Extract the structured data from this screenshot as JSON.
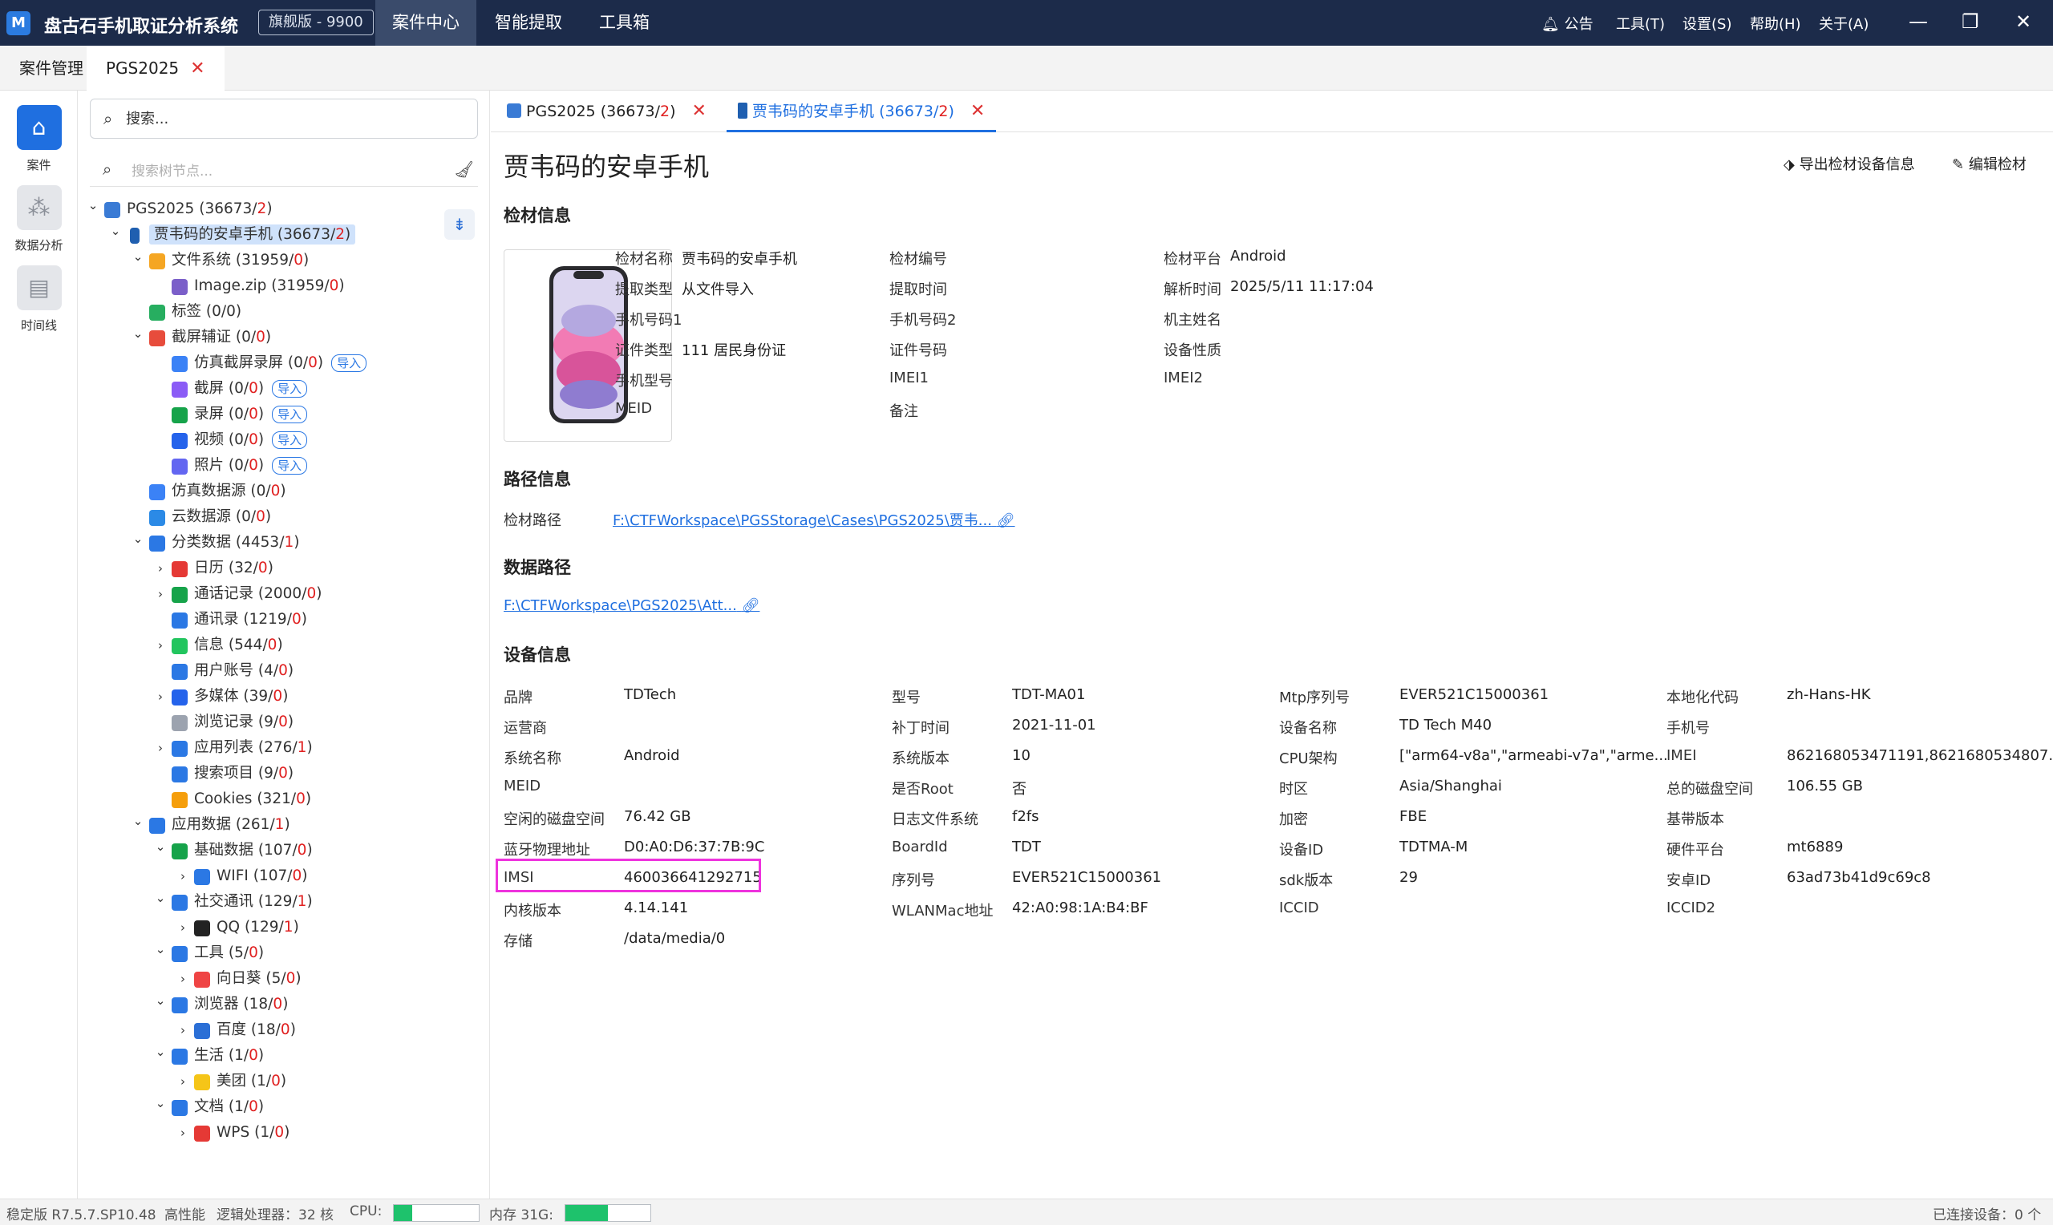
{
  "app": {
    "title": "盘古石手机取证分析系统",
    "edition": "旗舰版 - 9900",
    "logo_text": "M",
    "menus": [
      "案件中心",
      "智能提取",
      "工具箱"
    ],
    "right_menus": [
      "公告",
      "工具(T)",
      "设置(S)",
      "帮助(H)",
      "关于(A)"
    ]
  },
  "top_tabs": [
    {
      "label": "案件管理"
    },
    {
      "label": "PGS2025"
    }
  ],
  "rail": [
    {
      "label": "案件",
      "icon": "home-icon"
    },
    {
      "label": "数据分析",
      "icon": "share-icon"
    },
    {
      "label": "时间线",
      "icon": "timeline-icon"
    }
  ],
  "sidebar": {
    "search_placeholder": "搜索...",
    "tree_search_placeholder": "搜索树节点...",
    "import_label": "导入",
    "tree": [
      {
        "label": "PGS2025",
        "count": "36673",
        "red": "2",
        "level": 0,
        "chev": "open",
        "icon": "case-icon",
        "color": "#3a7bd5"
      },
      {
        "label": "贾韦码的安卓手机",
        "count": "36673",
        "red": "2",
        "level": 1,
        "chev": "open",
        "icon": "phone-icon",
        "color": "#1f5fb0",
        "selected": true
      },
      {
        "label": "文件系统",
        "count": "31959",
        "red": "0",
        "level": 2,
        "chev": "open",
        "icon": "folder-icon",
        "color": "#f5a623"
      },
      {
        "label": "Image.zip",
        "count": "31959",
        "red": "0",
        "level": 3,
        "chev": "",
        "icon": "zip-icon",
        "color": "#7b5fc9"
      },
      {
        "label": "标签",
        "count": "0",
        "red": "0",
        "level": 2,
        "chev": "",
        "icon": "tag-icon",
        "color": "#27ae60",
        "plain": true
      },
      {
        "label": "截屏辅证",
        "count": "0",
        "red": "0",
        "level": 2,
        "chev": "open",
        "icon": "screenshot-icon",
        "color": "#e74c3c"
      },
      {
        "label": "仿真截屏录屏",
        "count": "0",
        "red": "0",
        "level": 3,
        "chev": "",
        "icon": "emulate-icon",
        "color": "#3b82f6",
        "import": true
      },
      {
        "label": "截屏",
        "count": "0",
        "red": "0",
        "level": 3,
        "chev": "",
        "icon": "capture-icon",
        "color": "#8b5cf6",
        "import": true
      },
      {
        "label": "录屏",
        "count": "0",
        "red": "0",
        "level": 3,
        "chev": "",
        "icon": "record-icon",
        "color": "#16a34a",
        "import": true
      },
      {
        "label": "视频",
        "count": "0",
        "red": "0",
        "level": 3,
        "chev": "",
        "icon": "video-icon",
        "color": "#2563eb",
        "import": true
      },
      {
        "label": "照片",
        "count": "0",
        "red": "0",
        "level": 3,
        "chev": "",
        "icon": "photo-icon",
        "color": "#6366f1",
        "import": true
      },
      {
        "label": "仿真数据源",
        "count": "0",
        "red": "0",
        "level": 2,
        "chev": "",
        "icon": "sim-source-icon",
        "color": "#3b82f6"
      },
      {
        "label": "云数据源",
        "count": "0",
        "red": "0",
        "level": 2,
        "chev": "",
        "icon": "cloud-icon",
        "color": "#2b8ae6"
      },
      {
        "label": "分类数据",
        "count": "4453",
        "red": "1",
        "level": 2,
        "chev": "open",
        "icon": "category-icon",
        "color": "#2b78e4"
      },
      {
        "label": "日历",
        "count": "32",
        "red": "0",
        "level": 3,
        "chev": "closed",
        "icon": "calendar-icon",
        "color": "#e53935"
      },
      {
        "label": "通话记录",
        "count": "2000",
        "red": "0",
        "level": 3,
        "chev": "closed",
        "icon": "call-icon",
        "color": "#16a34a"
      },
      {
        "label": "通讯录",
        "count": "1219",
        "red": "0",
        "level": 3,
        "chev": "",
        "icon": "contacts-icon",
        "color": "#2b78e4"
      },
      {
        "label": "信息",
        "count": "544",
        "red": "0",
        "level": 3,
        "chev": "closed",
        "icon": "message-icon",
        "color": "#22c55e"
      },
      {
        "label": "用户账号",
        "count": "4",
        "red": "0",
        "level": 3,
        "chev": "",
        "icon": "account-icon",
        "color": "#2b78e4"
      },
      {
        "label": "多媒体",
        "count": "39",
        "red": "0",
        "level": 3,
        "chev": "closed",
        "icon": "media-icon",
        "color": "#2563eb"
      },
      {
        "label": "浏览记录",
        "count": "9",
        "red": "0",
        "level": 3,
        "chev": "",
        "icon": "history-icon",
        "color": "#9ca3af"
      },
      {
        "label": "应用列表",
        "count": "276",
        "red": "1",
        "level": 3,
        "chev": "closed",
        "icon": "applist-icon",
        "color": "#2b78e4"
      },
      {
        "label": "搜索项目",
        "count": "9",
        "red": "0",
        "level": 3,
        "chev": "",
        "icon": "search-item-icon",
        "color": "#2b78e4"
      },
      {
        "label": "Cookies",
        "count": "321",
        "red": "0",
        "level": 3,
        "chev": "",
        "icon": "cookie-icon",
        "color": "#f59e0b"
      },
      {
        "label": "应用数据",
        "count": "261",
        "red": "1",
        "level": 2,
        "chev": "open",
        "icon": "appdata-icon",
        "color": "#2b78e4"
      },
      {
        "label": "基础数据",
        "count": "107",
        "red": "0",
        "level": 3,
        "chev": "open",
        "icon": "basic-data-icon",
        "color": "#16a34a"
      },
      {
        "label": "WIFI",
        "count": "107",
        "red": "0",
        "level": 4,
        "chev": "closed",
        "icon": "wifi-icon",
        "color": "#2b78e4"
      },
      {
        "label": "社交通讯",
        "count": "129",
        "red": "1",
        "level": 3,
        "chev": "open",
        "icon": "social-icon",
        "color": "#2b78e4"
      },
      {
        "label": "QQ",
        "count": "129",
        "red": "1",
        "level": 4,
        "chev": "closed",
        "icon": "qq-icon",
        "color": "#222222"
      },
      {
        "label": "工具",
        "count": "5",
        "red": "0",
        "level": 3,
        "chev": "open",
        "icon": "tools-icon",
        "color": "#2b78e4"
      },
      {
        "label": "向日葵",
        "count": "5",
        "red": "0",
        "level": 4,
        "chev": "closed",
        "icon": "sunflower-icon",
        "color": "#ef4444"
      },
      {
        "label": "浏览器",
        "count": "18",
        "red": "0",
        "level": 3,
        "chev": "open",
        "icon": "browser-icon",
        "color": "#2b78e4"
      },
      {
        "label": "百度",
        "count": "18",
        "red": "0",
        "level": 4,
        "chev": "closed",
        "icon": "baidu-icon",
        "color": "#2b6fd6"
      },
      {
        "label": "生活",
        "count": "1",
        "red": "0",
        "level": 3,
        "chev": "open",
        "icon": "life-icon",
        "color": "#2b78e4"
      },
      {
        "label": "美团",
        "count": "1",
        "red": "0",
        "level": 4,
        "chev": "closed",
        "icon": "meituan-icon",
        "color": "#f5c518"
      },
      {
        "label": "文档",
        "count": "1",
        "red": "0",
        "level": 3,
        "chev": "open",
        "icon": "document-icon",
        "color": "#2b78e4"
      },
      {
        "label": "WPS",
        "count": "1",
        "red": "0",
        "level": 4,
        "chev": "closed",
        "icon": "wps-icon",
        "color": "#e53935"
      }
    ]
  },
  "main": {
    "tabs": [
      {
        "label": "PGS2025",
        "count": "36673",
        "red": "2"
      },
      {
        "label": "贾韦码的安卓手机",
        "count": "36673",
        "red": "2"
      }
    ],
    "device_title": "贾韦码的安卓手机",
    "export_label": "导出检材设备信息",
    "edit_label": "编辑检材",
    "section_material": "检材信息",
    "material_fields": [
      {
        "label": "检材名称",
        "value": "贾韦码的安卓手机"
      },
      {
        "label": "提取类型",
        "value": "从文件导入"
      },
      {
        "label": "手机号码1",
        "value": ""
      },
      {
        "label": "证件类型",
        "value": "111 居民身份证"
      },
      {
        "label": "手机型号",
        "value": ""
      },
      {
        "label": "MEID",
        "value": ""
      },
      {
        "label": "检材编号",
        "value": ""
      },
      {
        "label": "提取时间",
        "value": ""
      },
      {
        "label": "手机号码2",
        "value": ""
      },
      {
        "label": "证件号码",
        "value": ""
      },
      {
        "label": "IMEI1",
        "value": ""
      },
      {
        "label": "备注",
        "value": ""
      },
      {
        "label": "检材平台",
        "value": "Android"
      },
      {
        "label": "解析时间",
        "value": "2025/5/11 11:17:04"
      },
      {
        "label": "机主姓名",
        "value": ""
      },
      {
        "label": "设备性质",
        "value": ""
      },
      {
        "label": "IMEI2",
        "value": ""
      }
    ],
    "section_path": "路径信息",
    "path_label": "检材路径",
    "path_value": "F:\\CTFWorkspace\\PGSStorage\\Cases\\PGS2025\\贾韦...",
    "section_data_path": "数据路径",
    "data_path_value": "F:\\CTFWorkspace\\PGS2025\\Att...",
    "section_device": "设备信息",
    "device_fields": [
      {
        "label": "品牌",
        "value": "TDTech"
      },
      {
        "label": "运营商",
        "value": ""
      },
      {
        "label": "系统名称",
        "value": "Android"
      },
      {
        "label": "MEID",
        "value": ""
      },
      {
        "label": "空闲的磁盘空间",
        "value": "76.42 GB"
      },
      {
        "label": "蓝牙物理地址",
        "value": "D0:A0:D6:37:7B:9C"
      },
      {
        "label": "IMSI",
        "value": "460036641292715"
      },
      {
        "label": "内核版本",
        "value": "4.14.141"
      },
      {
        "label": "存储",
        "value": "/data/media/0"
      },
      {
        "label": "型号",
        "value": "TDT-MA01"
      },
      {
        "label": "补丁时间",
        "value": "2021-11-01"
      },
      {
        "label": "系统版本",
        "value": "10"
      },
      {
        "label": "是否Root",
        "value": "否"
      },
      {
        "label": "日志文件系统",
        "value": "f2fs"
      },
      {
        "label": "BoardId",
        "value": "TDT"
      },
      {
        "label": "序列号",
        "value": "EVER521C15000361"
      },
      {
        "label": "WLANMac地址",
        "value": "42:A0:98:1A:B4:BF"
      },
      {
        "label": "Mtp序列号",
        "value": "EVER521C15000361"
      },
      {
        "label": "设备名称",
        "value": "TD Tech M40"
      },
      {
        "label": "CPU架构",
        "value": "[\"arm64-v8a\",\"armeabi-v7a\",\"arme..."
      },
      {
        "label": "时区",
        "value": "Asia/Shanghai"
      },
      {
        "label": "加密",
        "value": "FBE"
      },
      {
        "label": "设备ID",
        "value": "TDTMA-M"
      },
      {
        "label": "sdk版本",
        "value": "29"
      },
      {
        "label": "ICCID",
        "value": ""
      },
      {
        "label": "本地化代码",
        "value": "zh-Hans-HK"
      },
      {
        "label": "手机号",
        "value": ""
      },
      {
        "label": "IMEI",
        "value": "862168053471191,8621680534807..."
      },
      {
        "label": "总的磁盘空间",
        "value": "106.55 GB"
      },
      {
        "label": "基带版本",
        "value": ""
      },
      {
        "label": "硬件平台",
        "value": "mt6889"
      },
      {
        "label": "安卓ID",
        "value": "63ad73b41d9c69c8"
      },
      {
        "label": "ICCID2",
        "value": ""
      }
    ]
  },
  "status": {
    "version": "稳定版 R7.5.7.SP10.48",
    "mode": "高性能",
    "cpu_info": "逻辑处理器：32 核",
    "cpu_label": "CPU:",
    "cpu_load": 0.22,
    "mem_label": "内存 31G:",
    "mem_load": 0.5,
    "connected": "已连接设备：0 个"
  },
  "colors": {
    "titlebar": "#1c2b4a",
    "accent": "#1f6fe0",
    "highlight": "#ee33dd",
    "meter": "#1ec26c"
  }
}
